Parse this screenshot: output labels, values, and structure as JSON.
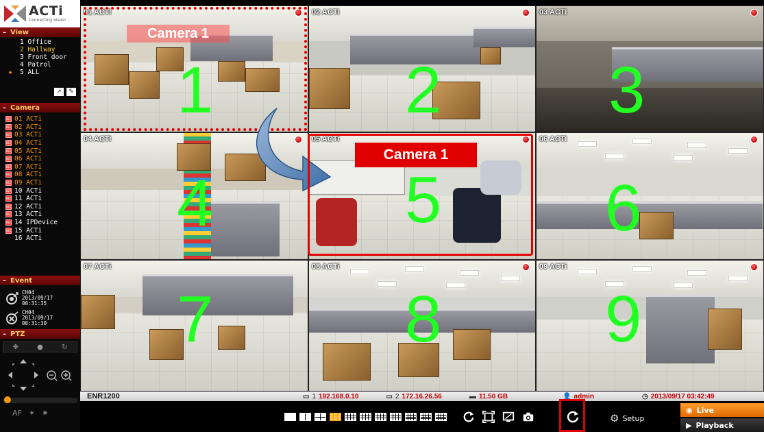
{
  "brand": {
    "name": "ACTi",
    "tagline": "Connecting Vision"
  },
  "sidebar": {
    "view": {
      "title": "View",
      "items": [
        {
          "label": "1 Office",
          "active": false
        },
        {
          "label": "2 Hallway",
          "active": true
        },
        {
          "label": "3 Front door",
          "active": false
        },
        {
          "label": "4 Patrol",
          "active": false
        },
        {
          "label": "5 ALL",
          "active": false
        }
      ]
    },
    "camera": {
      "title": "Camera",
      "items": [
        {
          "label": "01 ACTi",
          "recording": true
        },
        {
          "label": "02 ACTi",
          "recording": true
        },
        {
          "label": "03 ACTi",
          "recording": true
        },
        {
          "label": "04 ACTi",
          "recording": true
        },
        {
          "label": "05 ACTi",
          "recording": true
        },
        {
          "label": "06 ACTi",
          "recording": true
        },
        {
          "label": "07 ACTi",
          "recording": true
        },
        {
          "label": "08 ACTi",
          "recording": true
        },
        {
          "label": "09 ACTi",
          "recording": true
        },
        {
          "label": "10 ACTi",
          "recording": true
        },
        {
          "label": "11 ACTi",
          "recording": true
        },
        {
          "label": "12 ACTi",
          "recording": true
        },
        {
          "label": "13 ACTi",
          "recording": true
        },
        {
          "label": "14 IPDevice",
          "recording": true
        },
        {
          "label": "15 ACTi",
          "recording": true
        },
        {
          "label": "16 ACTi",
          "recording": false
        }
      ]
    },
    "event": {
      "title": "Event",
      "items": [
        {
          "channel": "CH04",
          "date": "2013/09/17",
          "time": "00:31:35"
        },
        {
          "channel": "CH04",
          "date": "2013/09/17",
          "time": "00:31:30"
        }
      ]
    },
    "ptz": {
      "title": "PTZ"
    }
  },
  "tiles": [
    {
      "label": "01 ACTi",
      "number": "1",
      "recording": true
    },
    {
      "label": "02 ACTi",
      "number": "2",
      "recording": true
    },
    {
      "label": "03 ACTi",
      "number": "3",
      "recording": true
    },
    {
      "label": "04 ACTi",
      "number": "4",
      "recording": true
    },
    {
      "label": "05 ACTi",
      "number": "5",
      "recording": true
    },
    {
      "label": "06 ACTi",
      "number": "6",
      "recording": true
    },
    {
      "label": "07 ACTi",
      "number": "7",
      "recording": false
    },
    {
      "label": "08 ACTi",
      "number": "8",
      "recording": true
    },
    {
      "label": "09 ACTi",
      "number": "9",
      "recording": true
    }
  ],
  "annotations": {
    "ghost_label": "Camera 1",
    "target_label": "Camera 1"
  },
  "status": {
    "model": "ENR1200",
    "lan1_prefix": "1",
    "lan1_ip": "192.168.0.10",
    "lan2_prefix": "2",
    "lan2_ip": "172.16.26.56",
    "storage": "11.50 GB",
    "user": "admin",
    "datetime": "2013/09/17 03:42:49"
  },
  "toolbar": {
    "setup_label": "Setup",
    "live_label": "Live",
    "playback_label": "Playback",
    "icons": [
      "refresh-icon",
      "fullscreen-icon",
      "monitor-icon",
      "snapshot-icon",
      "auto-cycle-icon",
      "logout-icon"
    ]
  },
  "colors": {
    "accent": "#ff9900",
    "highlight": "#e00000",
    "number": "#22ff22"
  }
}
